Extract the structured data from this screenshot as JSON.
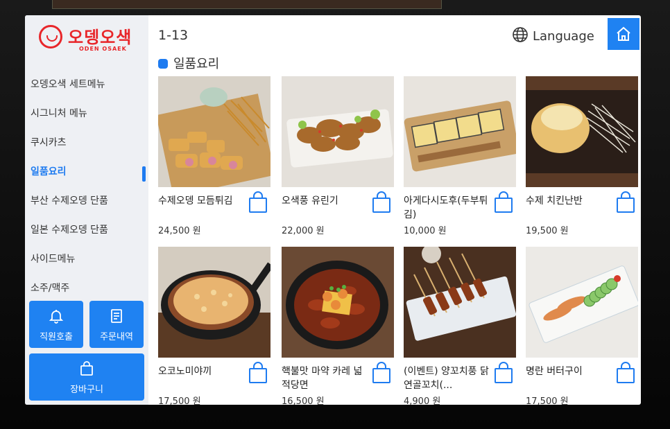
{
  "brand": {
    "title": "오뎅오색",
    "subtitle": "ODEN OSAEK"
  },
  "sidebar": {
    "items": [
      {
        "label": "오뎅오색 세트메뉴"
      },
      {
        "label": "시그니처 메뉴"
      },
      {
        "label": "쿠시카츠"
      },
      {
        "label": "일품요리"
      },
      {
        "label": "부산 수제오뎅 단품"
      },
      {
        "label": "일본 수제오뎅 단품"
      },
      {
        "label": "사이드메뉴"
      },
      {
        "label": "소주/맥주"
      }
    ],
    "active_index": 3,
    "call_staff_label": "직원호출",
    "order_history_label": "주문내역",
    "cart_label": "장바구니"
  },
  "header": {
    "page_indicator": "1-13",
    "language_label": "Language"
  },
  "section": {
    "title": "일품요리"
  },
  "items": [
    {
      "name": "수제오뎅 모듬튀김",
      "price": "24,500 원"
    },
    {
      "name": "오색풍 유린기",
      "price": "22,000 원"
    },
    {
      "name": "아게다시도후(두부튀김)",
      "price": "10,000 원"
    },
    {
      "name": "수제 치킨난반",
      "price": "19,500 원"
    },
    {
      "name": "오코노미야끼",
      "price": "17,500 원"
    },
    {
      "name": "핵불맛 마약 카레 넓적당면",
      "price": "16,500 원"
    },
    {
      "name": "(이벤트) 양꼬치풍 닭연골꼬치(...",
      "price": "4,900 원"
    },
    {
      "name": "명란 버터구이",
      "price": "17,500 원"
    }
  ],
  "colors": {
    "accent": "#1f82f2",
    "brand_red": "#e8262a",
    "sidebar_bg": "#eef0f4"
  },
  "icons": {
    "call_staff": "bell-icon",
    "order_history": "receipt-icon",
    "cart": "shopping-bag-icon",
    "language": "globe-icon",
    "home": "home-icon"
  }
}
